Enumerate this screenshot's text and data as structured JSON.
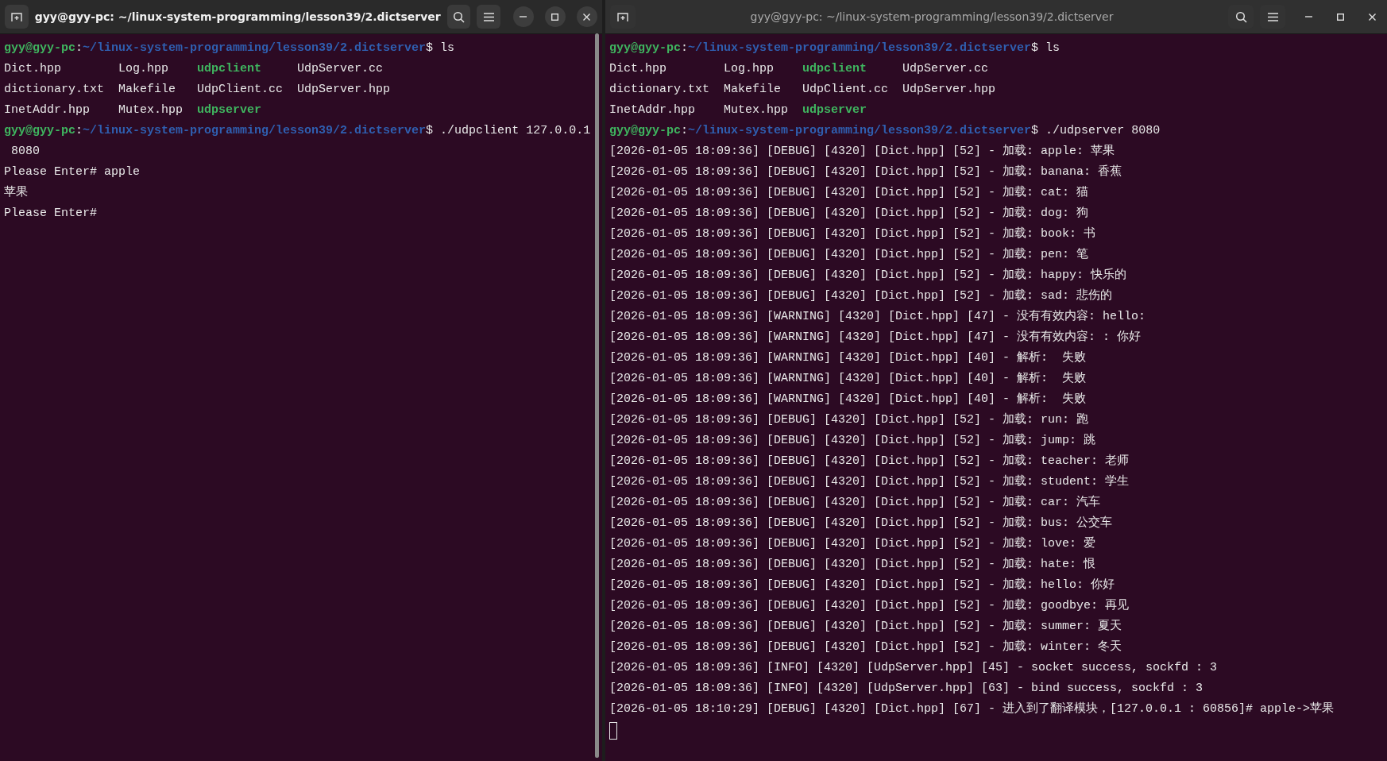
{
  "windows": [
    {
      "title": "gyy@gyy-pc: ~/linux-system-programming/lesson39/2.dictserver",
      "focused": true,
      "scrollbar": true,
      "lines": [
        {
          "kind": "prompt",
          "user": "gyy@gyy-pc",
          "separator": ":",
          "path": "~/linux-system-programming/lesson39/2.dictserver",
          "command": "$ ls"
        },
        {
          "kind": "files",
          "files": [
            {
              "name": "Dict.hpp",
              "executable": false
            },
            {
              "name": "Log.hpp",
              "executable": false
            },
            {
              "name": "udpclient",
              "executable": true
            },
            {
              "name": "UdpServer.cc",
              "executable": false
            }
          ]
        },
        {
          "kind": "files",
          "files": [
            {
              "name": "dictionary.txt",
              "executable": false
            },
            {
              "name": "Makefile",
              "executable": false
            },
            {
              "name": "UdpClient.cc",
              "executable": false
            },
            {
              "name": "UdpServer.hpp",
              "executable": false
            }
          ]
        },
        {
          "kind": "files",
          "files": [
            {
              "name": "InetAddr.hpp",
              "executable": false
            },
            {
              "name": "Mutex.hpp",
              "executable": false
            },
            {
              "name": "udpserver",
              "executable": true
            }
          ]
        },
        {
          "kind": "prompt",
          "user": "gyy@gyy-pc",
          "separator": ":",
          "path": "~/linux-system-programming/lesson39/2.dictserver",
          "command": "$ ./udpclient 127.0.0.1"
        },
        {
          "kind": "output",
          "text": " 8080"
        },
        {
          "kind": "output",
          "text": "Please Enter# apple"
        },
        {
          "kind": "output",
          "text": "苹果"
        },
        {
          "kind": "output",
          "text": "Please Enter#"
        }
      ]
    },
    {
      "title": "gyy@gyy-pc: ~/linux-system-programming/lesson39/2.dictserver",
      "focused": false,
      "cursor": true,
      "lines": [
        {
          "kind": "prompt",
          "user": "gyy@gyy-pc",
          "separator": ":",
          "path": "~/linux-system-programming/lesson39/2.dictserver",
          "command": "$ ls"
        },
        {
          "kind": "files",
          "files": [
            {
              "name": "Dict.hpp",
              "executable": false
            },
            {
              "name": "Log.hpp",
              "executable": false
            },
            {
              "name": "udpclient",
              "executable": true
            },
            {
              "name": "UdpServer.cc",
              "executable": false
            }
          ]
        },
        {
          "kind": "files",
          "files": [
            {
              "name": "dictionary.txt",
              "executable": false
            },
            {
              "name": "Makefile",
              "executable": false
            },
            {
              "name": "UdpClient.cc",
              "executable": false
            },
            {
              "name": "UdpServer.hpp",
              "executable": false
            }
          ]
        },
        {
          "kind": "files",
          "files": [
            {
              "name": "InetAddr.hpp",
              "executable": false
            },
            {
              "name": "Mutex.hpp",
              "executable": false
            },
            {
              "name": "udpserver",
              "executable": true
            }
          ]
        },
        {
          "kind": "prompt",
          "user": "gyy@gyy-pc",
          "separator": ":",
          "path": "~/linux-system-programming/lesson39/2.dictserver",
          "command": "$ ./udpserver 8080"
        },
        {
          "kind": "output",
          "text": "[2026-01-05 18:09:36] [DEBUG] [4320] [Dict.hpp] [52] - 加载: apple: 苹果"
        },
        {
          "kind": "output",
          "text": "[2026-01-05 18:09:36] [DEBUG] [4320] [Dict.hpp] [52] - 加载: banana: 香蕉"
        },
        {
          "kind": "output",
          "text": "[2026-01-05 18:09:36] [DEBUG] [4320] [Dict.hpp] [52] - 加载: cat: 猫"
        },
        {
          "kind": "output",
          "text": "[2026-01-05 18:09:36] [DEBUG] [4320] [Dict.hpp] [52] - 加载: dog: 狗"
        },
        {
          "kind": "output",
          "text": "[2026-01-05 18:09:36] [DEBUG] [4320] [Dict.hpp] [52] - 加载: book: 书"
        },
        {
          "kind": "output",
          "text": "[2026-01-05 18:09:36] [DEBUG] [4320] [Dict.hpp] [52] - 加载: pen: 笔"
        },
        {
          "kind": "output",
          "text": "[2026-01-05 18:09:36] [DEBUG] [4320] [Dict.hpp] [52] - 加载: happy: 快乐的"
        },
        {
          "kind": "output",
          "text": "[2026-01-05 18:09:36] [DEBUG] [4320] [Dict.hpp] [52] - 加载: sad: 悲伤的"
        },
        {
          "kind": "output",
          "text": "[2026-01-05 18:09:36] [WARNING] [4320] [Dict.hpp] [47] - 没有有效内容: hello:"
        },
        {
          "kind": "output",
          "text": "[2026-01-05 18:09:36] [WARNING] [4320] [Dict.hpp] [47] - 没有有效内容: : 你好"
        },
        {
          "kind": "output",
          "text": "[2026-01-05 18:09:36] [WARNING] [4320] [Dict.hpp] [40] - 解析:  失败"
        },
        {
          "kind": "output",
          "text": "[2026-01-05 18:09:36] [WARNING] [4320] [Dict.hpp] [40] - 解析:  失败"
        },
        {
          "kind": "output",
          "text": "[2026-01-05 18:09:36] [WARNING] [4320] [Dict.hpp] [40] - 解析:  失败"
        },
        {
          "kind": "output",
          "text": "[2026-01-05 18:09:36] [DEBUG] [4320] [Dict.hpp] [52] - 加载: run: 跑"
        },
        {
          "kind": "output",
          "text": "[2026-01-05 18:09:36] [DEBUG] [4320] [Dict.hpp] [52] - 加载: jump: 跳"
        },
        {
          "kind": "output",
          "text": "[2026-01-05 18:09:36] [DEBUG] [4320] [Dict.hpp] [52] - 加载: teacher: 老师"
        },
        {
          "kind": "output",
          "text": "[2026-01-05 18:09:36] [DEBUG] [4320] [Dict.hpp] [52] - 加载: student: 学生"
        },
        {
          "kind": "output",
          "text": "[2026-01-05 18:09:36] [DEBUG] [4320] [Dict.hpp] [52] - 加载: car: 汽车"
        },
        {
          "kind": "output",
          "text": "[2026-01-05 18:09:36] [DEBUG] [4320] [Dict.hpp] [52] - 加载: bus: 公交车"
        },
        {
          "kind": "output",
          "text": "[2026-01-05 18:09:36] [DEBUG] [4320] [Dict.hpp] [52] - 加载: love: 爱"
        },
        {
          "kind": "output",
          "text": "[2026-01-05 18:09:36] [DEBUG] [4320] [Dict.hpp] [52] - 加载: hate: 恨"
        },
        {
          "kind": "output",
          "text": "[2026-01-05 18:09:36] [DEBUG] [4320] [Dict.hpp] [52] - 加载: hello: 你好"
        },
        {
          "kind": "output",
          "text": "[2026-01-05 18:09:36] [DEBUG] [4320] [Dict.hpp] [52] - 加载: goodbye: 再见"
        },
        {
          "kind": "output",
          "text": "[2026-01-05 18:09:36] [DEBUG] [4320] [Dict.hpp] [52] - 加载: summer: 夏天"
        },
        {
          "kind": "output",
          "text": "[2026-01-05 18:09:36] [DEBUG] [4320] [Dict.hpp] [52] - 加载: winter: 冬天"
        },
        {
          "kind": "output",
          "text": "[2026-01-05 18:09:36] [INFO] [4320] [UdpServer.hpp] [45] - socket success, sockfd : 3"
        },
        {
          "kind": "output",
          "text": "[2026-01-05 18:09:36] [INFO] [4320] [UdpServer.hpp] [63] - bind success, sockfd : 3"
        },
        {
          "kind": "output",
          "text": "[2026-01-05 18:10:29] [DEBUG] [4320] [Dict.hpp] [67] - 进入到了翻译模块，[127.0.0.1 : 60856]# apple->苹果"
        }
      ]
    }
  ]
}
